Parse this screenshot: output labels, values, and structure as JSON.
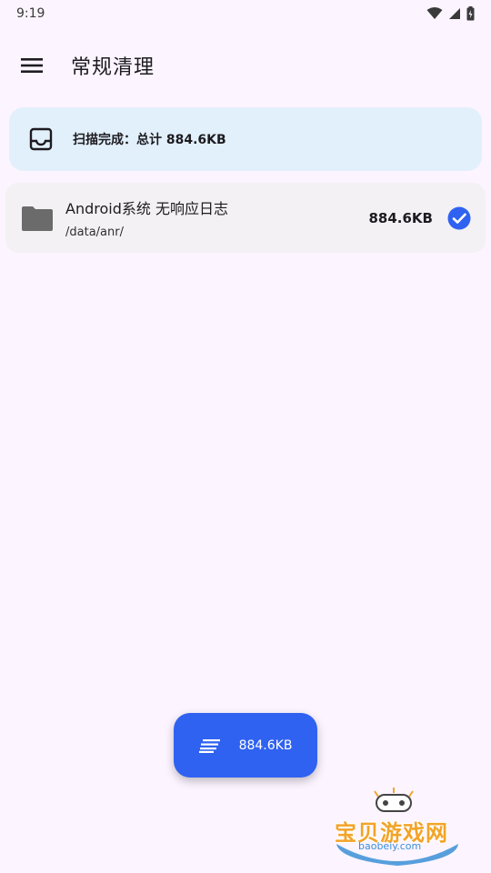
{
  "status_bar": {
    "time": "9:19",
    "icons": [
      "wifi-icon",
      "signal-icon",
      "battery-icon"
    ]
  },
  "app_bar": {
    "title": "常规清理",
    "menu_icon": "menu-icon"
  },
  "summary": {
    "text": "扫描完成：总计 884.6KB",
    "icon": "inbox-icon"
  },
  "items": [
    {
      "name": "Android系统 无响应日志",
      "path": "/data/anr/",
      "size": "884.6KB",
      "checked": true
    }
  ],
  "fab": {
    "label": "884.6KB",
    "icon": "clean-sweep-icon"
  },
  "watermark": {
    "text": "宝贝游戏网",
    "url": "baobeiy.com"
  },
  "colors": {
    "background": "#fcf4ff",
    "accent": "#2f62f1",
    "summary_bg": "#e2f0fb",
    "item_bg": "#f3f1f4",
    "folder": "#6b6b6b"
  }
}
